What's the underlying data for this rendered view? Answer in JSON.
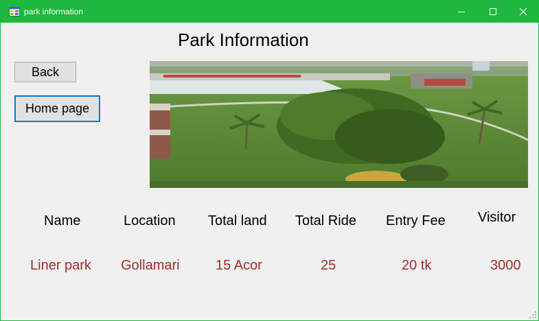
{
  "window": {
    "title": "park information",
    "controls": [
      "minimize",
      "maximize",
      "close"
    ]
  },
  "page": {
    "heading": "Park Information"
  },
  "buttons": {
    "back": "Back",
    "home": "Home page"
  },
  "image": {
    "description_icon": "park-photo"
  },
  "table": {
    "headers": [
      "Name",
      "Location",
      "Total land",
      "Total Ride",
      "Entry Fee",
      "Visitor"
    ],
    "row": [
      "Liner park",
      "Gollamari",
      "15 Acor",
      "25",
      "20 tk",
      "3000"
    ]
  },
  "colors": {
    "titlebar": "#1db83d",
    "value_text": "#a52a2a",
    "focus_border": "#0078d7"
  }
}
